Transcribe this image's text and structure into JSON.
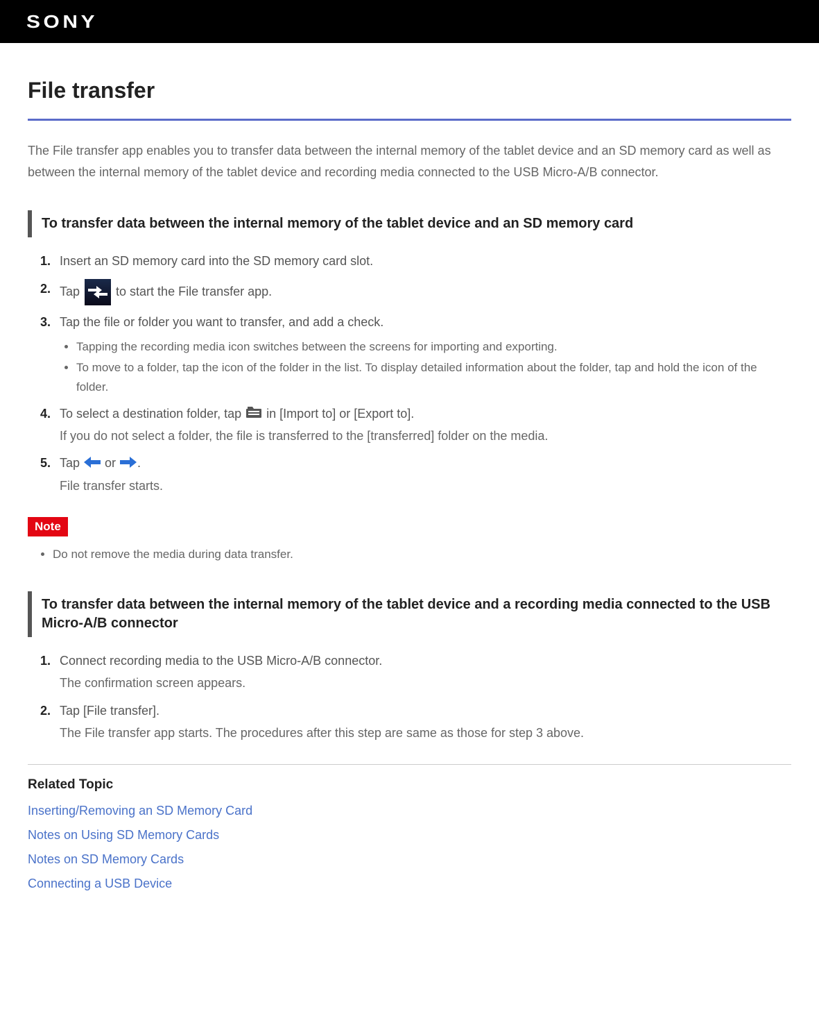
{
  "brand": "SONY",
  "page_title": "File transfer",
  "intro": "The File transfer app enables you to transfer data between the internal memory of the tablet device and an SD memory card as well as between the internal memory of the tablet device and recording media connected to the USB Micro-A/B connector.",
  "section1": {
    "heading": "To transfer data between the internal memory of the tablet device and an SD memory card",
    "step1": "Insert an SD memory card into the SD memory card slot.",
    "step2_a": "Tap ",
    "step2_b": " to start the File transfer app.",
    "step3_main": "Tap the file or folder you want to transfer, and add a check.",
    "step3_bullet1": "Tapping the recording media icon switches between the screens for importing and exporting.",
    "step3_bullet2": "To move to a folder, tap the icon of the folder in the list. To display detailed information about the folder, tap and hold the icon of the folder.",
    "step4_a": "To select a destination folder, tap ",
    "step4_b": " in [Import to] or [Export to].",
    "step4_sub": "If you do not select a folder, the file is transferred to the [transferred] folder on the media.",
    "step5_a": "Tap ",
    "step5_or": " or ",
    "step5_b": ".",
    "step5_sub": "File transfer starts."
  },
  "note": {
    "label": "Note",
    "item1": "Do not remove the media during data transfer."
  },
  "section2": {
    "heading": "To transfer data between the internal memory of the tablet device and a recording media connected to the USB Micro-A/B connector",
    "step1_main": "Connect recording media to the USB Micro-A/B connector.",
    "step1_sub": "The confirmation screen appears.",
    "step2_main": "Tap [File transfer].",
    "step2_sub": "The File transfer app starts. The procedures after this step are same as those for step 3 above."
  },
  "related": {
    "title": "Related Topic",
    "links": [
      "Inserting/Removing an SD Memory Card",
      "Notes on Using SD Memory Cards",
      "Notes on SD Memory Cards",
      "Connecting a USB Device"
    ]
  }
}
